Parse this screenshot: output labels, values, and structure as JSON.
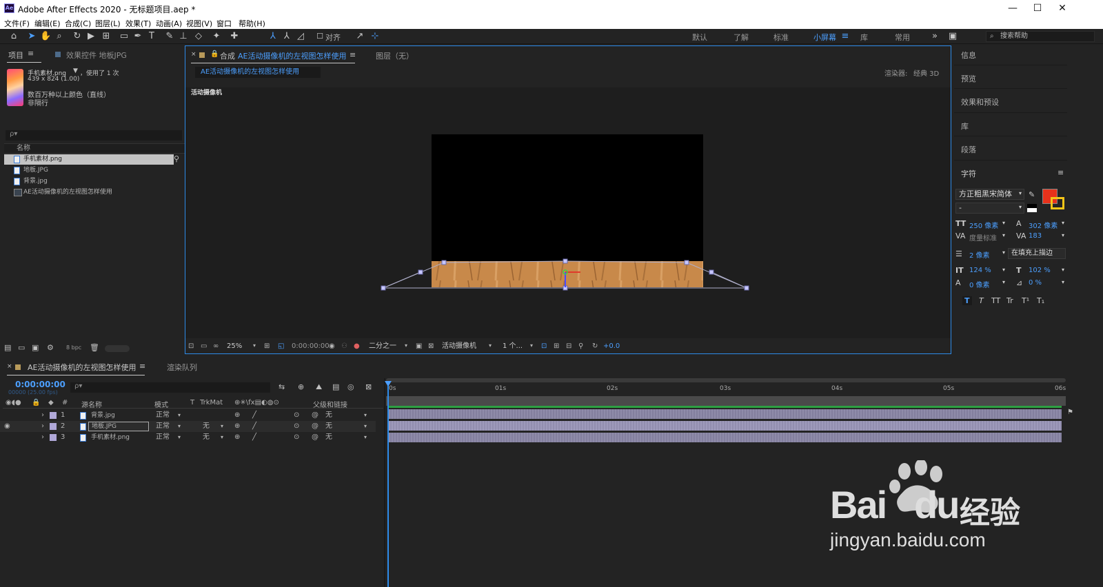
{
  "window": {
    "title": "Adobe After Effects 2020 - 无标题项目.aep *",
    "app_icon": "Ae"
  },
  "menu": [
    "文件(F)",
    "编辑(E)",
    "合成(C)",
    "图层(L)",
    "效果(T)",
    "动画(A)",
    "视图(V)",
    "窗口",
    "帮助(H)"
  ],
  "toolbar": {
    "align_label": "对齐",
    "workspaces": [
      "默认",
      "了解",
      "标准",
      "小屏幕",
      "库",
      "常用"
    ],
    "active_workspace": "小屏幕",
    "search_placeholder": "搜索帮助"
  },
  "project_panel": {
    "tab_project": "项目",
    "tab_effects": "效果控件 地板JPG",
    "selected_name": "手机素材.png",
    "usage": "，使用了 1 次",
    "dimensions": "439 x 824 (1.00)",
    "color_info": "数百万种以上颜色（直线）",
    "interlace": "非隔行",
    "search_icon_text": "ρ▾",
    "column_name": "名称",
    "items": [
      "手机素材.png",
      "地板.JPG",
      "背景.jpg",
      "AE活动摄像机的左视图怎样使用"
    ],
    "bpc": "8 bpc"
  },
  "comp_panel": {
    "tab_label": "合成",
    "comp_name": "AE活动摄像机的左视图怎样使用",
    "layer_tab": "图层（无）",
    "subtab": "AE活动摄像机的左视图怎样使用",
    "renderer_label": "渲染器:",
    "renderer_value": "经典 3D",
    "view_label": "活动摄像机",
    "zoom": "25%",
    "timecode": "0:00:00:00",
    "resolution": "二分之一",
    "camera": "活动摄像机",
    "views": "1 个...",
    "exposure": "+0.0"
  },
  "right_panel": {
    "items": [
      "信息",
      "预览",
      "效果和预设",
      "库",
      "段落",
      "字符"
    ],
    "font": "方正粗黑宋简体",
    "font_style": "-",
    "font_size": "250 像素",
    "leading": "302 像素",
    "kerning": "度量标准",
    "tracking": "183",
    "stroke_width": "2 像素",
    "stroke_type": "在填充上描边",
    "vert_scale": "124 %",
    "horiz_scale": "102 %",
    "baseline": "0 像素",
    "tsume": "0 %",
    "fill_color": "#e8321b",
    "stroke_color": "#f5c518",
    "style_buttons": [
      "T",
      "T",
      "TT",
      "Tr",
      "T¹",
      "T₁"
    ]
  },
  "timeline": {
    "tab_label": "AE活动摄像机的左视图怎样使用",
    "render_queue": "渲染队列",
    "timecode": "0:00:00:00",
    "frame_info": "00000 (25.00 fps)",
    "columns": {
      "num": "#",
      "source": "源名称",
      "mode": "模式",
      "t": "T",
      "trkmat": "TrkMat",
      "parent": "父级和链接"
    },
    "ruler": [
      "0s",
      "01s",
      "02s",
      "03s",
      "04s",
      "05s",
      "06s"
    ],
    "layers": [
      {
        "num": "1",
        "name": "背景.jpg",
        "mode": "正常",
        "trkmat": "",
        "parent": "无"
      },
      {
        "num": "2",
        "name": "地板.JPG",
        "mode": "正常",
        "trkmat": "无",
        "parent": "无"
      },
      {
        "num": "3",
        "name": "手机素材.png",
        "mode": "正常",
        "trkmat": "无",
        "parent": "无"
      }
    ]
  },
  "watermark": {
    "brand": "Bai",
    "brand2": "du",
    "cn": "经验",
    "url": "jingyan.baidu.com"
  }
}
